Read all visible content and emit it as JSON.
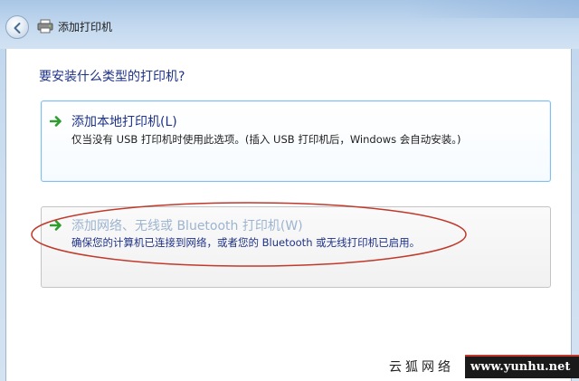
{
  "window": {
    "title": "添加打印机",
    "title_icon": "printer-icon",
    "back_icon": "back-arrow-icon"
  },
  "main": {
    "heading": "要安装什么类型的打印机?",
    "options": [
      {
        "title": "添加本地打印机(L)",
        "description": "仅当没有 USB 打印机时使用此选项。(插入 USB 打印机后，Windows 会自动安装。)",
        "icon": "green-arrow-icon"
      },
      {
        "title": "添加网络、无线或 Bluetooth 打印机(W)",
        "description": "确保您的计算机已连接到网络，或者您的 Bluetooth 或无线打印机已启用。",
        "icon": "green-arrow-icon"
      }
    ]
  },
  "watermark": {
    "text": "云狐网络",
    "url": "www.yunhu.net"
  },
  "colors": {
    "heading": "#1e3287",
    "link_disabled": "#9db4cf",
    "highlight_ellipse": "#c0392b",
    "arrow_green": "#2e9d2e"
  }
}
